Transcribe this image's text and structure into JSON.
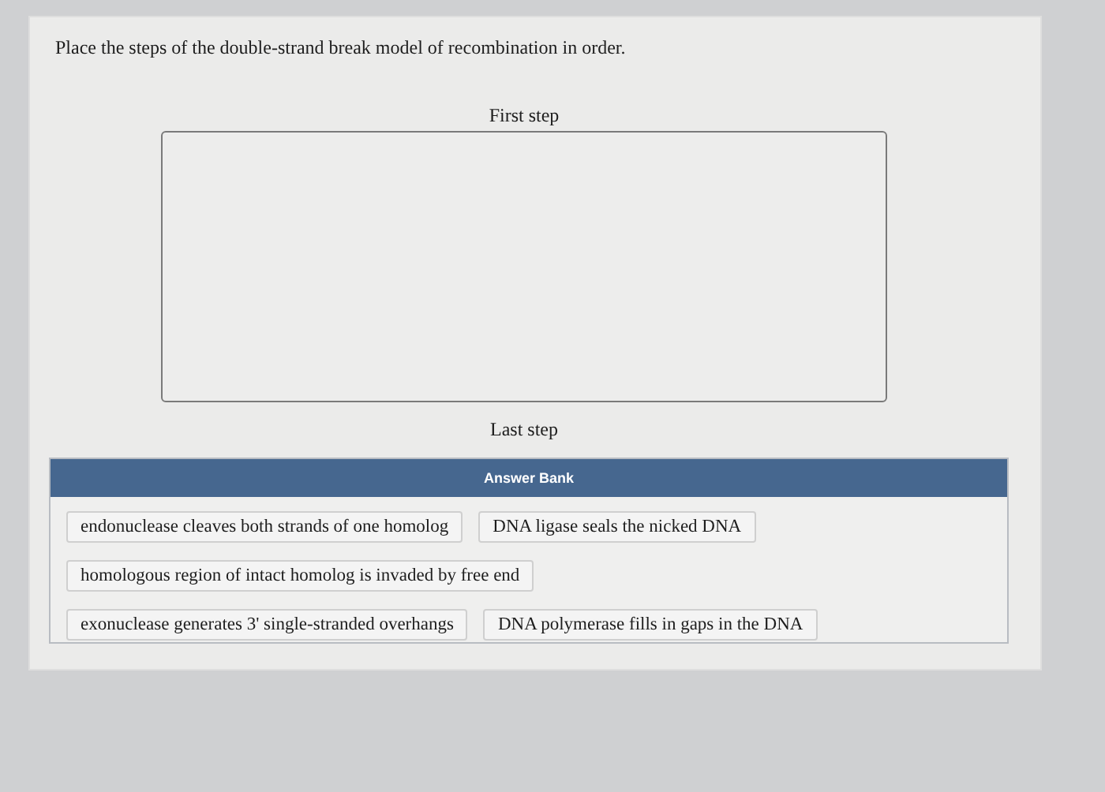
{
  "prompt": "Place the steps of the double-strand break model of recombination in order.",
  "first_label": "First step",
  "last_label": "Last step",
  "answer_bank": {
    "title": "Answer Bank",
    "rows": [
      [
        "endonuclease cleaves both strands of one homolog",
        "DNA ligase seals the nicked DNA"
      ],
      [
        "homologous region of intact homolog is invaded by free end"
      ],
      [
        "exonuclease generates 3' single-stranded overhangs",
        "DNA polymerase fills in gaps in the DNA"
      ]
    ]
  }
}
